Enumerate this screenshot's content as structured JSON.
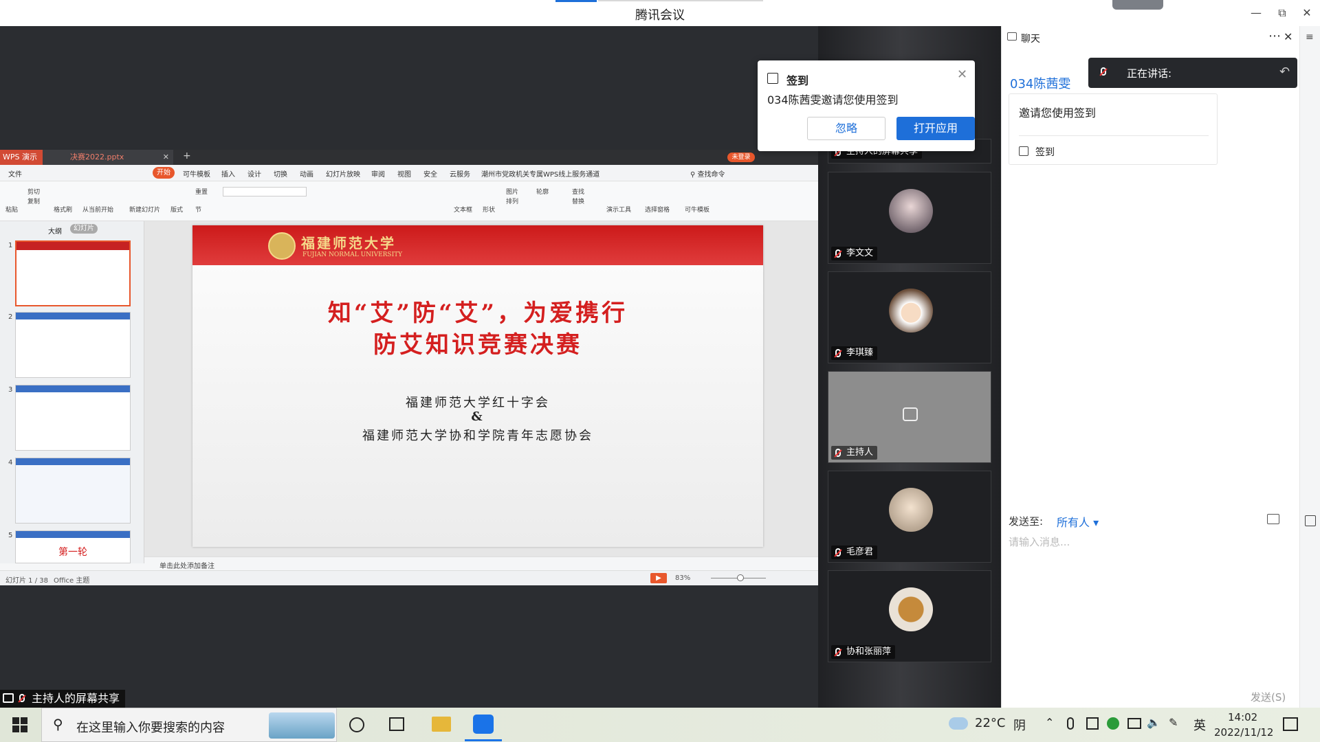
{
  "window": {
    "title": "腾讯会议"
  },
  "wps": {
    "logo": "WPS 演示",
    "doc_tab": "决赛2022.pptx",
    "login_badge": "未登录",
    "menu": [
      "文件",
      "开始",
      "可牛模板",
      "插入",
      "设计",
      "切换",
      "动画",
      "幻灯片放映",
      "审阅",
      "视图",
      "安全",
      "云服务",
      "潮州市党政机关专属WPS线上服务通道"
    ],
    "search_cmd": "查找命令",
    "ribbon": [
      "粘贴",
      "剪切",
      "复制",
      "格式刷",
      "从当前开始",
      "新建幻灯片",
      "版式",
      "节",
      "重置",
      "文本框",
      "形状",
      "排列",
      "图片",
      "轮廓",
      "替换",
      "查找",
      "演示工具",
      "选择窗格",
      "可牛模板"
    ],
    "left_tabs": [
      "大纲",
      "幻灯片"
    ],
    "thumbs": [
      "1",
      "2",
      "3",
      "4",
      "5"
    ],
    "thumb5_text": "第一轮",
    "slide": {
      "univ_cn": "福建师范大学",
      "univ_en": "FUJIAN NORMAL UNIVERSITY",
      "title1": "知“艾”防“艾”，为爱携行",
      "title2": "防艾知识竞赛决赛",
      "org1": "福建师范大学红十字会",
      "amp": "&",
      "org2": "福建师范大学协和学院青年志愿协会"
    },
    "notes_placeholder": "单击此处添加备注",
    "status": {
      "slide_pos": "幻灯片 1 / 38",
      "theme": "Office 主题",
      "zoom": "83%"
    }
  },
  "share_label": "主持人的屏幕共享",
  "participants": [
    {
      "name": "主持人的屏幕共享"
    },
    {
      "name": "李文文"
    },
    {
      "name": "李琪臻"
    },
    {
      "name": "主持人"
    },
    {
      "name": "毛彦君"
    },
    {
      "name": "协和张丽萍"
    }
  ],
  "popup": {
    "title": "签到",
    "message": "034陈茜雯邀请您使用签到",
    "ignore": "忽略",
    "open": "打开应用"
  },
  "chat": {
    "header": "聊天",
    "speaking": "正在讲话:",
    "sender": "034陈茜雯",
    "card_text": "邀请您使用签到",
    "card_link": "签到",
    "send_to_label": "发送至:",
    "send_to_value": "所有人",
    "input_placeholder": "请输入消息...",
    "send_button": "发送(S)"
  },
  "taskbar": {
    "search_placeholder": "在这里输入你要搜索的内容",
    "weather_temp": "22°C",
    "weather_desc": "阴",
    "ime": "英",
    "time": "14:02",
    "date": "2022/11/12"
  },
  "colors": {
    "accent": "#1e6fd9",
    "wps_red": "#d24a34",
    "slide_red": "#d41f1f",
    "popup_button": "#1e6fd9"
  }
}
